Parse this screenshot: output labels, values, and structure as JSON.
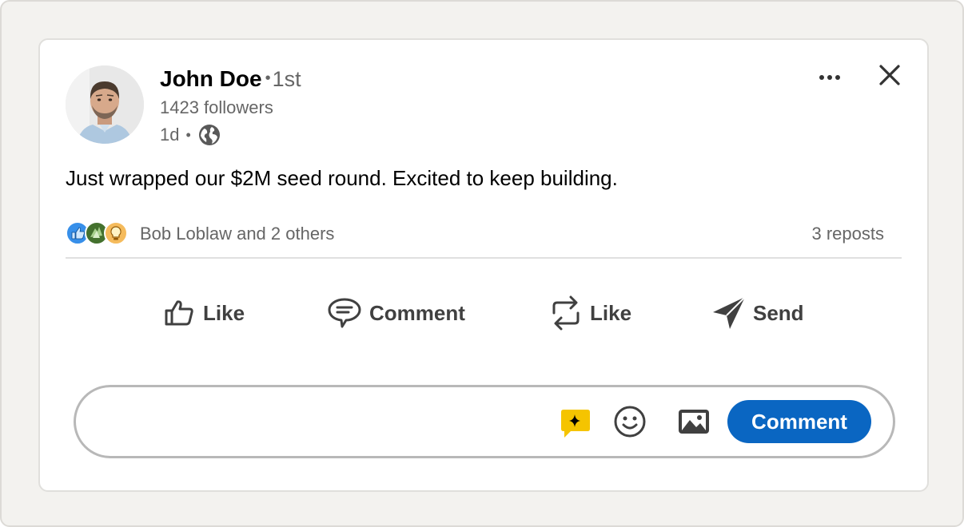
{
  "post": {
    "author": {
      "name": "John Doe",
      "separator": "•",
      "connection_degree": "1st",
      "followers": "1423 followers"
    },
    "time_ago": "1d",
    "meta_separator": "•",
    "visibility_icon": "globe-icon",
    "text": "Just wrapped our $2M seed round. Excited to keep building."
  },
  "header_actions": {
    "more_icon": "ellipsis-icon",
    "close_icon": "close-icon"
  },
  "social": {
    "reaction_icons": [
      "like-reaction-icon",
      "celebrate-reaction-icon",
      "insightful-reaction-icon"
    ],
    "reactors": "Bob Loblaw and 2 others",
    "reposts": "3 reposts"
  },
  "actions": {
    "like": "Like",
    "comment": "Comment",
    "repost": "Like",
    "send": "Send"
  },
  "composer": {
    "placeholder": "",
    "ai_icon": "ai-sparkle-icon",
    "emoji_icon": "emoji-icon",
    "image_icon": "image-icon",
    "submit_label": "Comment"
  },
  "colors": {
    "brand_blue": "#0a66c2",
    "text_secondary": "#666666",
    "action_gray": "#404040",
    "ai_yellow": "#f5c400",
    "page_background": "#f3f2ef"
  }
}
